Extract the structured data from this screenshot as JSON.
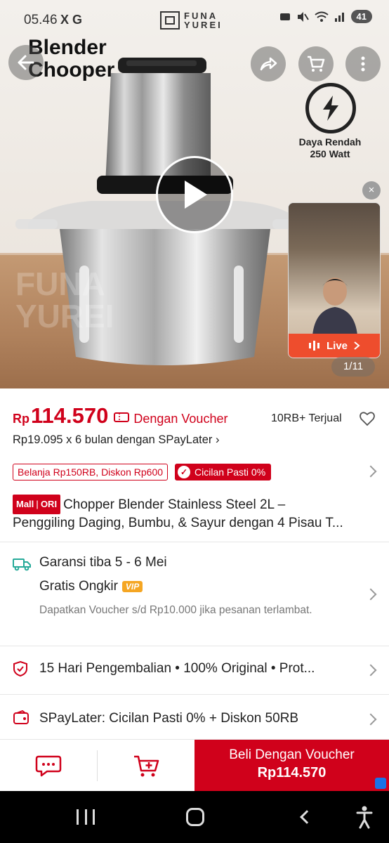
{
  "status_bar": {
    "time": "05.46",
    "extra_icons": "X G",
    "battery": "41"
  },
  "hero": {
    "brand_line1": "FUNA",
    "brand_line2": "YUREI",
    "product_title_line1": "Blender",
    "product_title_line2": "Chooper",
    "power_label_line1": "Daya Rendah",
    "power_label_line2": "250 Watt",
    "image_counter": "1/11",
    "live_label": "Live",
    "close_symbol": "×"
  },
  "price": {
    "currency": "Rp",
    "value": "114.570",
    "voucher_label": "Dengan Voucher",
    "sold": "10RB+ Terjual",
    "installment": "Rp19.095 x 6 bulan dengan SPayLater ›"
  },
  "promo": {
    "discount_tag": "Belanja Rp150RB, Diskon Rp600",
    "installment_tag": "Cicilan Pasti 0%"
  },
  "product": {
    "mall_label": "Mall",
    "ori_label": "ORI",
    "name_line1": "Chopper Blender Stainless Steel 2L –",
    "name_line2": "Penggiling Daging, Bumbu, & Sayur dengan 4 Pisau T..."
  },
  "shipping": {
    "guarantee": "Garansi tiba 5 - 6 Mei",
    "free_shipping": "Gratis Ongkir",
    "vip_badge": "VIP",
    "note": "Dapatkan Voucher s/d Rp10.000 jika pesanan terlambat."
  },
  "guarantees": {
    "text": "15 Hari Pengembalian  •  100% Original  •  Prot..."
  },
  "spaylater": {
    "text": "SPayLater: Cicilan Pasti 0% + Diskon 50RB"
  },
  "bottom_bar": {
    "buy_label": "Beli Dengan Voucher",
    "buy_price": "Rp114.570"
  },
  "colors": {
    "accent": "#d0011b",
    "live": "#ee4d2d",
    "vip": "#f5a623"
  }
}
